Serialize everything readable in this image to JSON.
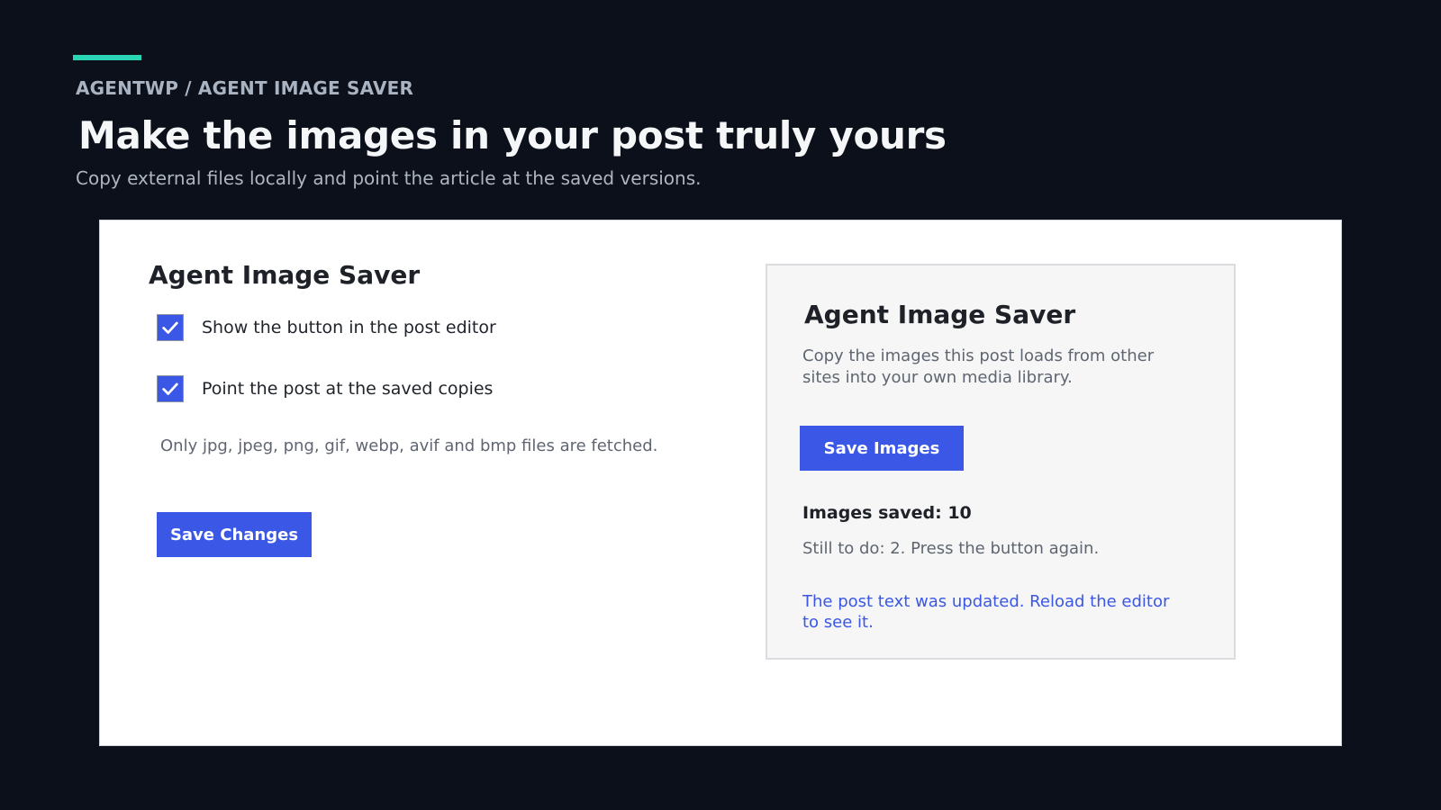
{
  "header": {
    "breadcrumb": "AGENTWP / AGENT IMAGE SAVER",
    "title": "Make the images in your post truly yours",
    "subtitle": "Copy external files locally and point the article at the saved versions."
  },
  "settings": {
    "title": "Agent Image Saver",
    "options": [
      {
        "label": "Show the button in the post editor",
        "checked": true
      },
      {
        "label": "Point the post at the saved copies",
        "checked": true
      }
    ],
    "help_text": "Only jpg, jpeg, png, gif, webp, avif and bmp files are fetched.",
    "save_label": "Save Changes"
  },
  "panel": {
    "title": "Agent Image Saver",
    "description": "Copy the images this post loads from other sites into your own media library.",
    "button_label": "Save Images",
    "saved_count": "Images saved: 10",
    "todo": "Still to do: 2. Press the button again.",
    "notice": "The post text was updated. Reload the editor to see it."
  },
  "colors": {
    "accent": "#2bd4b4",
    "primary": "#3b57e6",
    "background": "#0b101a"
  },
  "icons": {
    "checkbox": "checkmark-icon"
  }
}
